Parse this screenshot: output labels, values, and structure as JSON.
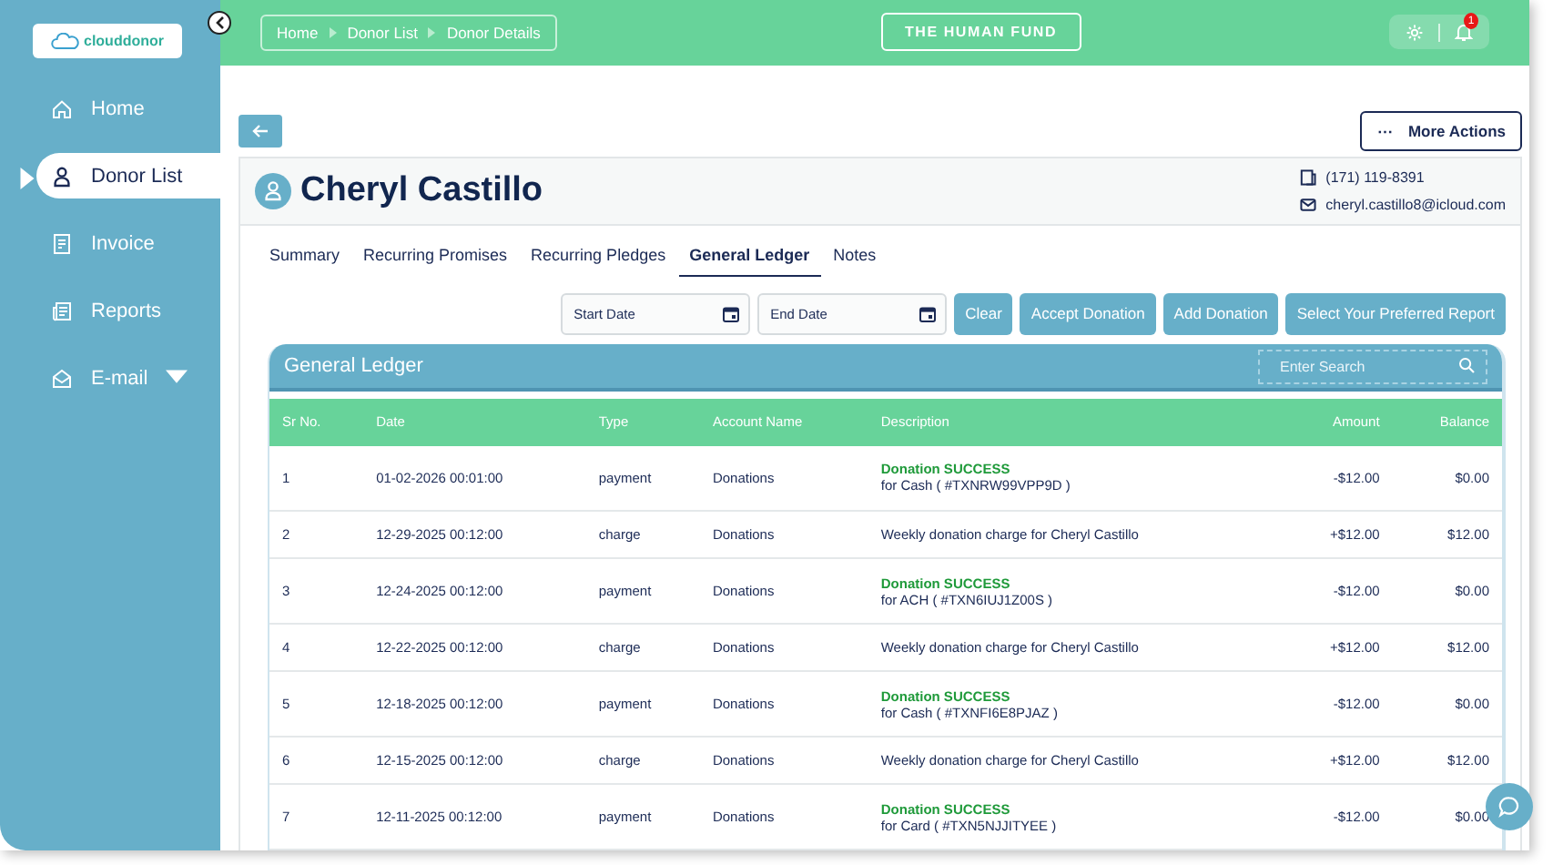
{
  "logo": {
    "text": "clouddonor"
  },
  "sidebar": {
    "items": [
      {
        "label": "Home",
        "selected": false
      },
      {
        "label": "Donor List",
        "selected": true
      },
      {
        "label": "Invoice",
        "selected": false
      },
      {
        "label": "Reports",
        "selected": false
      },
      {
        "label": "E-mail",
        "selected": false,
        "dropdown": true
      }
    ]
  },
  "breadcrumb": [
    "Home",
    "Donor List",
    "Donor Details"
  ],
  "organization": "THE HUMAN FUND",
  "notifications": {
    "count": "1"
  },
  "more_actions": {
    "icon": "⋯",
    "label": "More Actions"
  },
  "donor": {
    "name": "Cheryl Castillo",
    "phone": "(171) 119-8391",
    "email": "cheryl.castillo8@icloud.com"
  },
  "tabs": [
    {
      "label": "Summary",
      "selected": false
    },
    {
      "label": "Recurring Promises",
      "selected": false
    },
    {
      "label": "Recurring Pledges",
      "selected": false
    },
    {
      "label": "General Ledger",
      "selected": true
    },
    {
      "label": "Notes",
      "selected": false
    }
  ],
  "filters": {
    "start_date": {
      "placeholder": "Start Date"
    },
    "end_date": {
      "placeholder": "End Date"
    }
  },
  "actions": [
    "Clear",
    "Accept Donation",
    "Add Donation",
    "Select Your Preferred Report"
  ],
  "ledger": {
    "title": "General Ledger",
    "search": {
      "placeholder": "Enter Search"
    },
    "columns": [
      "Sr No.",
      "Date",
      "Type",
      "Account Name",
      "Description",
      "Amount",
      "Balance"
    ],
    "rows": [
      {
        "kind": "payment",
        "sr": "1",
        "date": "01-02-2026 00:01:00",
        "type": "payment",
        "account": "Donations",
        "status": "Donation SUCCESS",
        "detail": "for Cash ( #TXNRW99VPP9D )",
        "amount": "-$12.00",
        "balance": "$0.00"
      },
      {
        "kind": "charge",
        "sr": "2",
        "date": "12-29-2025 00:12:00",
        "type": "charge",
        "account": "Donations",
        "detail": "Weekly donation charge for Cheryl Castillo",
        "amount": "+$12.00",
        "balance": "$12.00"
      },
      {
        "kind": "payment",
        "sr": "3",
        "date": "12-24-2025 00:12:00",
        "type": "payment",
        "account": "Donations",
        "status": "Donation SUCCESS",
        "detail": "for ACH ( #TXN6IUJ1Z00S )",
        "amount": "-$12.00",
        "balance": "$0.00"
      },
      {
        "kind": "charge",
        "sr": "4",
        "date": "12-22-2025 00:12:00",
        "type": "charge",
        "account": "Donations",
        "detail": "Weekly donation charge for Cheryl Castillo",
        "amount": "+$12.00",
        "balance": "$12.00"
      },
      {
        "kind": "payment",
        "sr": "5",
        "date": "12-18-2025 00:12:00",
        "type": "payment",
        "account": "Donations",
        "status": "Donation SUCCESS",
        "detail": "for Cash ( #TXNFI6E8PJAZ )",
        "amount": "-$12.00",
        "balance": "$0.00"
      },
      {
        "kind": "charge",
        "sr": "6",
        "date": "12-15-2025 00:12:00",
        "type": "charge",
        "account": "Donations",
        "detail": "Weekly donation charge for Cheryl Castillo",
        "amount": "+$12.00",
        "balance": "$12.00"
      },
      {
        "kind": "payment",
        "sr": "7",
        "date": "12-11-2025 00:12:00",
        "type": "payment",
        "account": "Donations",
        "status": "Donation SUCCESS",
        "detail": "for Card ( #TXN5NJJITYEE )",
        "amount": "-$12.00",
        "balance": "$0.00"
      }
    ]
  }
}
